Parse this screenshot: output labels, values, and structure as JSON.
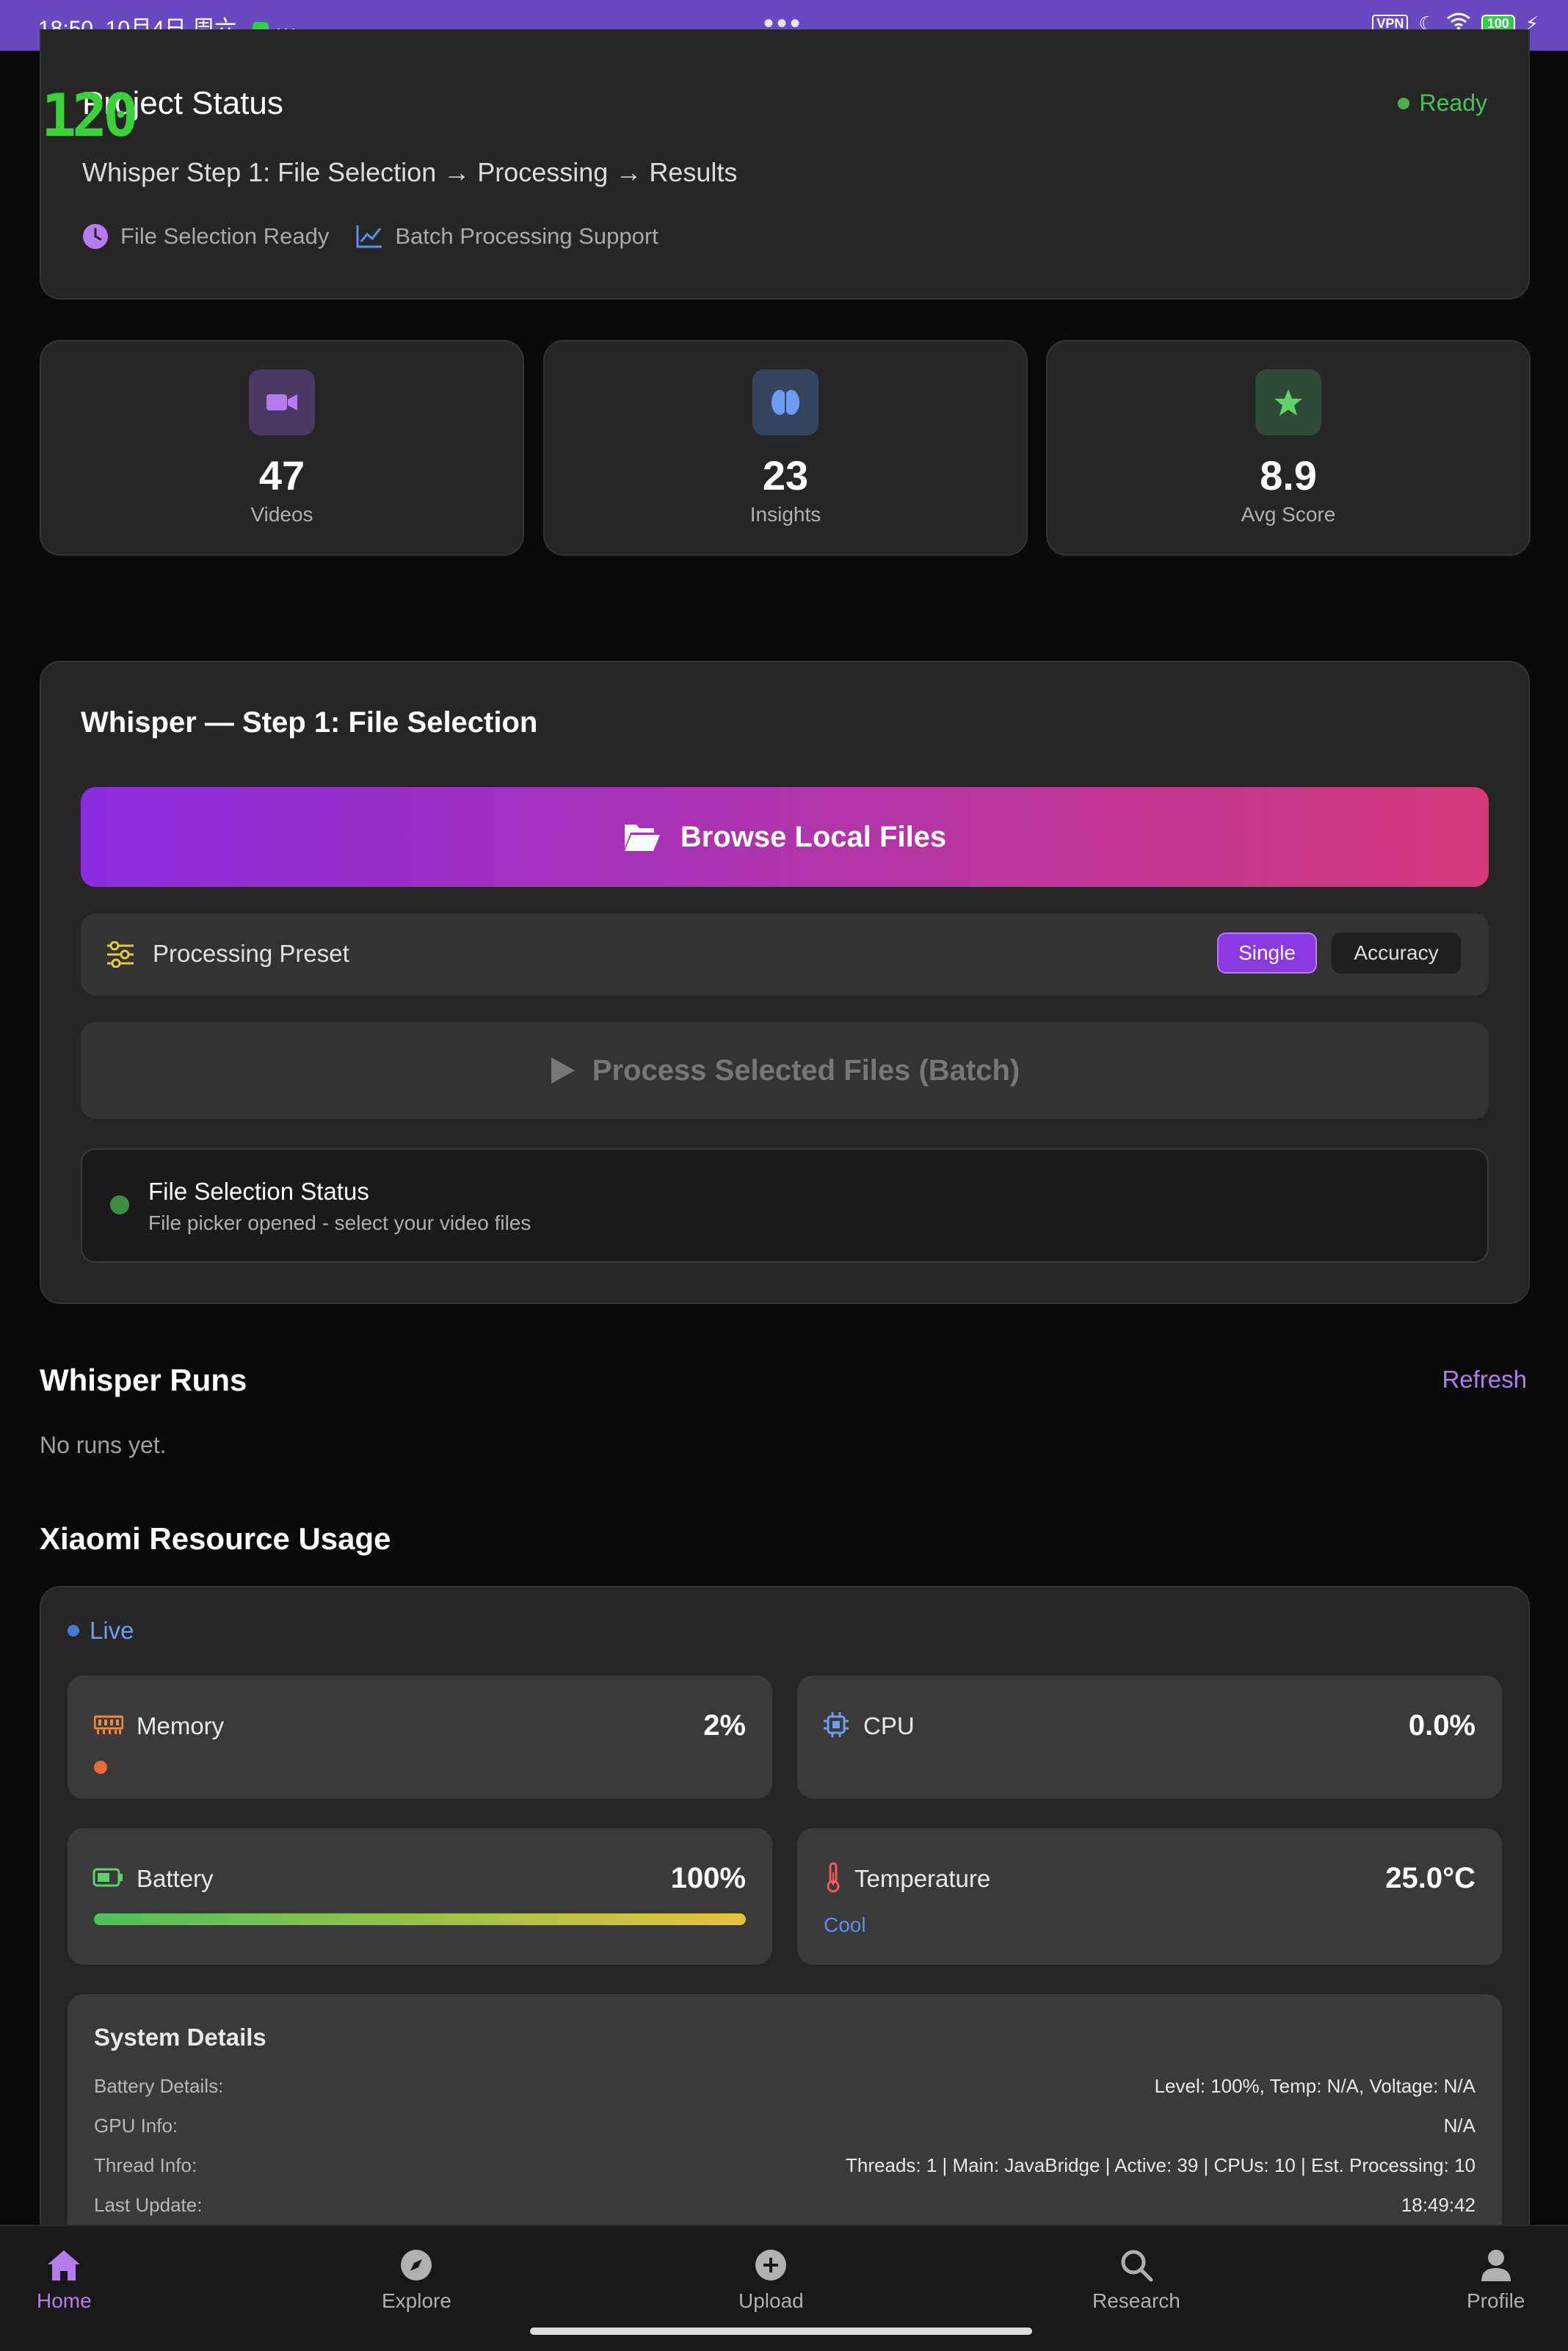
{
  "status_bar": {
    "time": "18:50",
    "date": "10月4日 周六",
    "more": "···",
    "center_dots": "•••",
    "vpn": "VPN",
    "battery": "100"
  },
  "overlay_logo": "120",
  "project": {
    "title": "Project Status",
    "status": "Ready",
    "subtitle": "Whisper Step 1: File Selection → Processing → Results",
    "tag1": "File Selection Ready",
    "tag2": "Batch Processing Support"
  },
  "stats": [
    {
      "value": "47",
      "label": "Videos",
      "icon": "video-icon"
    },
    {
      "value": "23",
      "label": "Insights",
      "icon": "brain-icon"
    },
    {
      "value": "8.9",
      "label": "Avg Score",
      "icon": "star-icon"
    }
  ],
  "whisper": {
    "title": "Whisper — Step 1: File Selection",
    "browse_label": "Browse Local Files",
    "preset_label": "Processing Preset",
    "preset_options": [
      "Single",
      "Accuracy"
    ],
    "preset_selected": "Single",
    "process_label": "Process Selected Files (Batch)",
    "fs_status_title": "File Selection Status",
    "fs_status_text": "File picker opened - select your video files"
  },
  "runs": {
    "title": "Whisper Runs",
    "refresh": "Refresh",
    "empty": "No runs yet."
  },
  "resources": {
    "title": "Xiaomi Resource Usage",
    "live": "Live",
    "memory": {
      "label": "Memory",
      "value": "2%"
    },
    "cpu": {
      "label": "CPU",
      "value": "0.0%"
    },
    "battery": {
      "label": "Battery",
      "value": "100%",
      "level": 1.0
    },
    "temperature": {
      "label": "Temperature",
      "value": "25.0°C",
      "state": "Cool"
    }
  },
  "system_details": {
    "title": "System Details",
    "rows": [
      {
        "key": "Battery Details:",
        "value": "Level: 100%, Temp: N/A, Voltage: N/A"
      },
      {
        "key": "GPU Info:",
        "value": "N/A"
      },
      {
        "key": "Thread Info:",
        "value": "Threads: 1 | Main: JavaBridge | Active: 39 | CPUs: 10 | Est. Processing: 10"
      },
      {
        "key": "Last Update:",
        "value": "18:49:42"
      }
    ]
  },
  "nav": {
    "items": [
      "Home",
      "Explore",
      "Upload",
      "Research",
      "Profile"
    ],
    "active": "Home"
  },
  "colors": {
    "accent": "#a259ff",
    "ready_green": "#4caf50",
    "status_bar": "#6a48c0"
  }
}
